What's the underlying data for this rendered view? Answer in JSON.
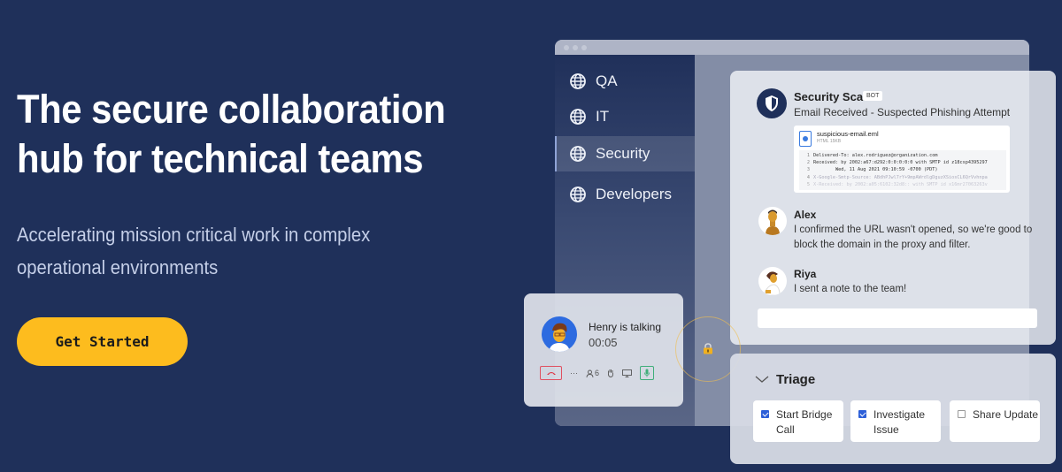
{
  "hero": {
    "title": "The secure collaboration hub for technical teams",
    "subtitle": "Accelerating mission critical work in complex operational environments",
    "cta_label": "Get Started"
  },
  "colors": {
    "background": "#1f305a",
    "cta": "#fdbc1e",
    "accent_blue": "#2d5fd8"
  },
  "sidebar": {
    "items": [
      {
        "label": "QA",
        "icon": "globe-icon",
        "active": false
      },
      {
        "label": "IT",
        "icon": "globe-icon",
        "active": false
      },
      {
        "label": "Security",
        "icon": "globe-icon",
        "active": true
      },
      {
        "label": "Developers",
        "icon": "globe-icon",
        "active": false
      }
    ]
  },
  "chat": {
    "bot": {
      "name": "Security Scan",
      "badge": "BOT",
      "message": "Email Received - Suspected Phishing Attempt",
      "attachment": {
        "name": "suspicious-email.eml",
        "meta": "HTML 15KB",
        "lines": [
          {
            "n": "1",
            "text": "Delivered-To: alex.rodriguez@organization.com"
          },
          {
            "n": "2",
            "text": "Received: by 2002:a67:d292:0:0:0:0:0 with SMTP id z18csp4395297"
          },
          {
            "n": "3",
            "text": "        Wed, 11 Aug 2021 09:10:59 -0700 (PDT)"
          },
          {
            "n": "4",
            "text": "X-Google-Smtp-Source: ABdhPJwl7rY+9mpAWrdlgDguzXSiosCL6QrVvhnpa"
          },
          {
            "n": "5",
            "text": "X-Received: by 2002:a05:6102:32d8:: with SMTP id x16mr27063263v"
          }
        ]
      }
    },
    "messages": [
      {
        "name": "Alex",
        "text": "I confirmed the URL wasn't opened, so we're good to block the domain in the proxy and filter."
      },
      {
        "name": "Riya",
        "text": "I sent a note to the team!"
      }
    ],
    "input_value": ""
  },
  "call": {
    "status": "Henry is talking",
    "duration": "00:05",
    "participants": "6"
  },
  "triage": {
    "title": "Triage",
    "tasks": [
      {
        "label": "Start Bridge Call",
        "checked": true
      },
      {
        "label": "Investigate Issue",
        "checked": true
      },
      {
        "label": "Share Update",
        "checked": false
      }
    ]
  }
}
